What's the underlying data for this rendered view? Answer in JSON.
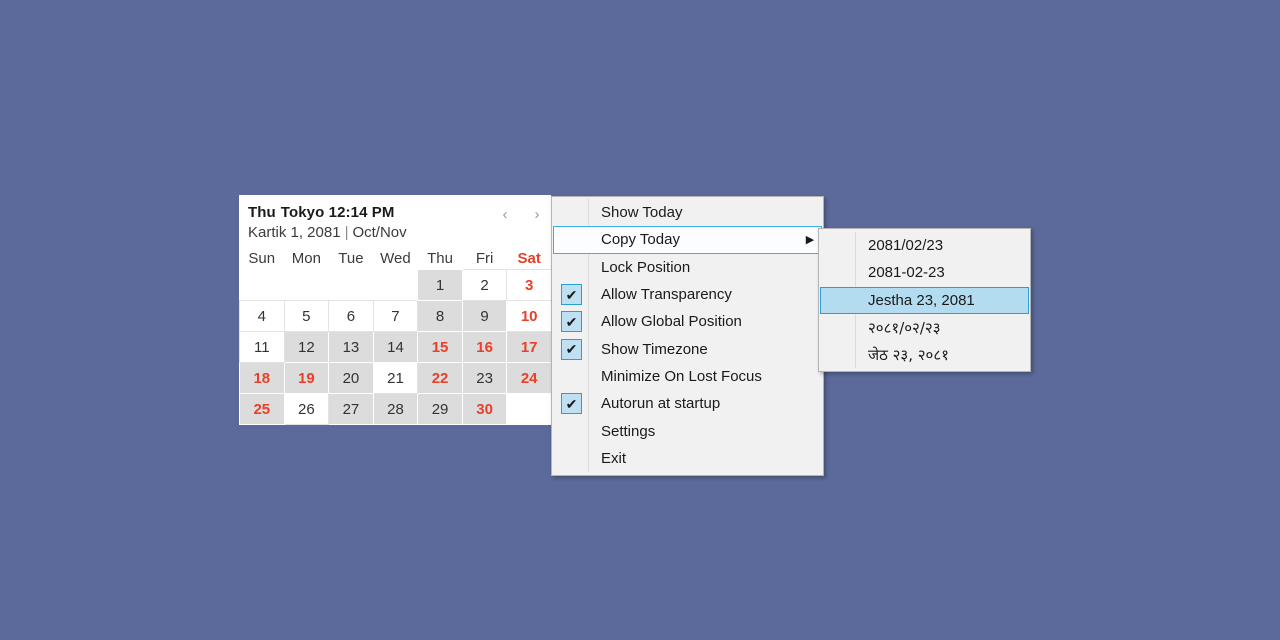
{
  "background_color": "#5b6a9a",
  "calendar": {
    "timezone_line": {
      "weekday": "Thu",
      "city": "Tokyo",
      "time": "12:14 PM"
    },
    "date_line": {
      "bs_date": "Kartik 1, 2081",
      "separator": "|",
      "ad_months": "Oct/Nov"
    },
    "nav": {
      "prev_icon": "‹",
      "next_icon": "›"
    },
    "weekday_headers": [
      "Sun",
      "Mon",
      "Tue",
      "Wed",
      "Thu",
      "Fri",
      "Sat"
    ],
    "weeks": [
      [
        {
          "day": "",
          "style": "empty"
        },
        {
          "day": "",
          "style": "empty"
        },
        {
          "day": "",
          "style": "empty"
        },
        {
          "day": "",
          "style": "empty"
        },
        {
          "day": "1",
          "style": "shade"
        },
        {
          "day": "2",
          "style": "plain"
        },
        {
          "day": "3",
          "style": "plain red"
        }
      ],
      [
        {
          "day": "4",
          "style": "plain"
        },
        {
          "day": "5",
          "style": "plain"
        },
        {
          "day": "6",
          "style": "plain"
        },
        {
          "day": "7",
          "style": "plain"
        },
        {
          "day": "8",
          "style": "shade"
        },
        {
          "day": "9",
          "style": "shade"
        },
        {
          "day": "10",
          "style": "plain red"
        }
      ],
      [
        {
          "day": "11",
          "style": "plain"
        },
        {
          "day": "12",
          "style": "shade"
        },
        {
          "day": "13",
          "style": "shade"
        },
        {
          "day": "14",
          "style": "shade"
        },
        {
          "day": "15",
          "style": "shade red"
        },
        {
          "day": "16",
          "style": "shade red"
        },
        {
          "day": "17",
          "style": "shade red"
        }
      ],
      [
        {
          "day": "18",
          "style": "shade red"
        },
        {
          "day": "19",
          "style": "shade red"
        },
        {
          "day": "20",
          "style": "shade"
        },
        {
          "day": "21",
          "style": "plain"
        },
        {
          "day": "22",
          "style": "shade red"
        },
        {
          "day": "23",
          "style": "shade"
        },
        {
          "day": "24",
          "style": "shade red"
        }
      ],
      [
        {
          "day": "25",
          "style": "shade red"
        },
        {
          "day": "26",
          "style": "plain"
        },
        {
          "day": "27",
          "style": "shade"
        },
        {
          "day": "28",
          "style": "shade"
        },
        {
          "day": "29",
          "style": "shade"
        },
        {
          "day": "30",
          "style": "shade red"
        },
        {
          "day": "",
          "style": "empty"
        }
      ]
    ],
    "colors": {
      "holiday_red": "#e8402a",
      "shaded_cell": "#dcdcdc",
      "panel": "#ffffff"
    }
  },
  "context_menu": {
    "items": [
      {
        "label": "Show Today",
        "checked": false,
        "submenu": false,
        "selected": false
      },
      {
        "label": "Copy Today",
        "checked": false,
        "submenu": true,
        "selected": true
      },
      {
        "label": "Lock Position",
        "checked": false,
        "submenu": false,
        "selected": false
      },
      {
        "label": "Allow Transparency",
        "checked": true,
        "submenu": false,
        "selected": false
      },
      {
        "label": "Allow Global Position",
        "checked": true,
        "submenu": false,
        "selected": false
      },
      {
        "label": "Show Timezone",
        "checked": true,
        "submenu": false,
        "selected": false
      },
      {
        "label": "Minimize On Lost Focus",
        "checked": false,
        "submenu": false,
        "selected": false
      },
      {
        "label": "Autorun at startup",
        "checked": true,
        "submenu": false,
        "selected": false
      },
      {
        "label": "Settings",
        "checked": false,
        "submenu": false,
        "selected": false
      },
      {
        "label": "Exit",
        "checked": false,
        "submenu": false,
        "selected": false
      }
    ],
    "check_glyph": "✔",
    "submenu_arrow": "▶",
    "selection_border_color": "#3daee9"
  },
  "copy_today_submenu": {
    "items": [
      {
        "label": "2081/02/23",
        "hover": false,
        "devanagari": false
      },
      {
        "label": "2081-02-23",
        "hover": false,
        "devanagari": false
      },
      {
        "label": "Jestha 23, 2081",
        "hover": true,
        "devanagari": false
      },
      {
        "label": "२०८१/०२/२३",
        "hover": false,
        "devanagari": true
      },
      {
        "label": "जेठ २३, २०८१",
        "hover": false,
        "devanagari": true
      }
    ],
    "hover_color": "#b4dcf0"
  }
}
